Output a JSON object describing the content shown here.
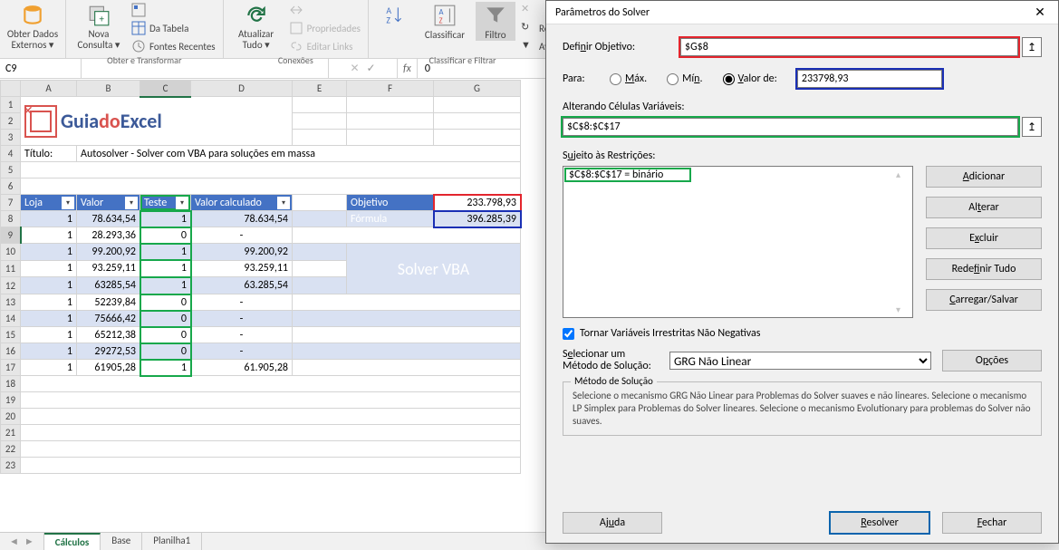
{
  "ribbon": {
    "obter_dados": "Obter Dados\nExternos ▾",
    "nova_consulta": "Nova\nConsulta ▾",
    "da_tabela": "Da Tabela",
    "fontes_recentes": "Fontes Recentes",
    "group_obter": "Obter e Transformar",
    "atualizar": "Atualizar\nTudo ▾",
    "propriedades": "Propriedades",
    "editar_links": "Editar Links",
    "group_conexoes": "Conexões",
    "classificar": "Classificar",
    "filtro": "Filtro",
    "reaplicar": "Re",
    "avancado": "Av",
    "group_classificar": "Classificar e Filtrar"
  },
  "cellref": {
    "name": "C9",
    "fx": "fx",
    "formula": "0"
  },
  "cols": [
    "A",
    "B",
    "C",
    "D",
    "E",
    "F",
    "G"
  ],
  "title_label": "Título:",
  "title_text": "Autosolver - Solver com VBA para soluções em massa",
  "logo": {
    "guia": "Guia",
    "do": "do",
    "excel": "Excel"
  },
  "headers": {
    "loja": "Loja",
    "valor": "Valor",
    "teste": "Teste",
    "valorcalc": "Valor calculado"
  },
  "rows": [
    {
      "loja": "1",
      "valor": "78.634,54",
      "teste": "1",
      "calc": "78.634,54"
    },
    {
      "loja": "1",
      "valor": "28.293,36",
      "teste": "0",
      "calc": "-"
    },
    {
      "loja": "1",
      "valor": "99.200,92",
      "teste": "1",
      "calc": "99.200,92"
    },
    {
      "loja": "1",
      "valor": "93.259,11",
      "teste": "1",
      "calc": "93.259,11"
    },
    {
      "loja": "1",
      "valor": "63285,54",
      "teste": "1",
      "calc": "63.285,54"
    },
    {
      "loja": "1",
      "valor": "52239,84",
      "teste": "0",
      "calc": "-"
    },
    {
      "loja": "1",
      "valor": "75666,42",
      "teste": "0",
      "calc": "-"
    },
    {
      "loja": "1",
      "valor": "65212,38",
      "teste": "0",
      "calc": "-"
    },
    {
      "loja": "1",
      "valor": "29272,53",
      "teste": "0",
      "calc": "-"
    },
    {
      "loja": "1",
      "valor": "61905,28",
      "teste": "1",
      "calc": "61.905,28"
    }
  ],
  "side": {
    "objetivo_lbl": "Objetivo",
    "objetivo_val": "233.798,93",
    "formula_lbl": "Fórmula",
    "formula_val": "396.285,39",
    "btn": "Solver VBA"
  },
  "dialog": {
    "title": "Parâmetros do Solver",
    "definir": "Definir Objetivo:",
    "objetivo_cell": "$G$8",
    "para": "Para:",
    "max": "Máx.",
    "min": "Mín.",
    "valor_de": "Valor de:",
    "valor_de_val": "233798,93",
    "alterando": "Alterando Células Variáveis:",
    "alterando_val": "$C$8:$C$17",
    "sujeito": "Sujeito às Restrições:",
    "restricao": "$C$8:$C$17 = binário",
    "adicionar": "Adicionar",
    "alterar": "Alterar",
    "excluir": "Excluir",
    "redefinir": "Redefinir Tudo",
    "carregar": "Carregar/Salvar",
    "negativas": "Tornar Variáveis Irrestritas Não Negativas",
    "selecionar": "Selecionar um Método de Solução:",
    "metodo_sel": "GRG Não Linear",
    "opcoes": "Opções",
    "metodo_title": "Método de Solução",
    "metodo_desc": "Selecione o mecanismo GRG Não Linear para Problemas do Solver suaves e não lineares. Selecione o mecanismo LP Simplex para Problemas do Solver lineares. Selecione o mecanismo Evolutionary para problemas do Solver não suaves.",
    "ajuda": "Ajuda",
    "resolver": "Resolver",
    "fechar": "Fechar"
  },
  "sheets": {
    "active": "Cálculos",
    "s2": "Base",
    "s3": "Planilha1"
  }
}
